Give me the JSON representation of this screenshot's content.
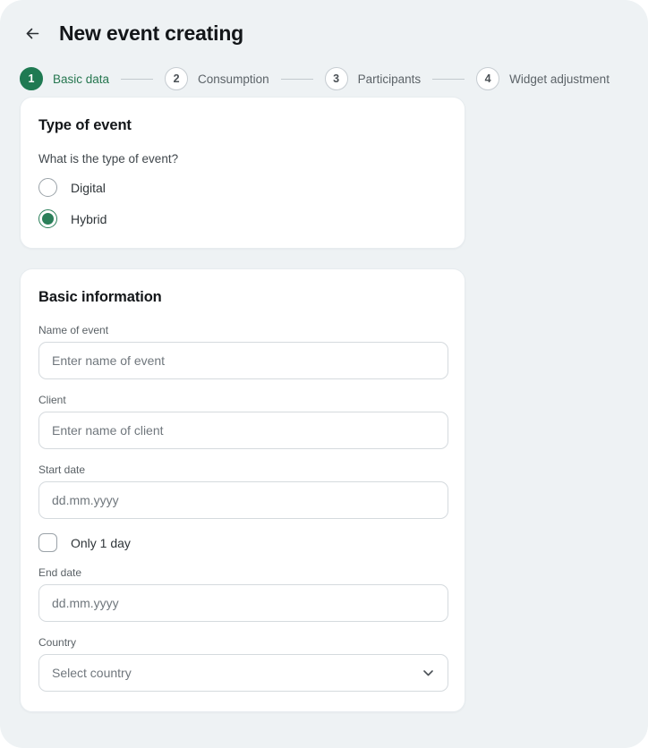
{
  "header": {
    "back_icon": "arrow-left-icon",
    "title": "New event creating"
  },
  "stepper": {
    "steps": [
      {
        "number": "1",
        "label": "Basic data",
        "state": "active"
      },
      {
        "number": "2",
        "label": "Consumption",
        "state": "inactive"
      },
      {
        "number": "3",
        "label": "Participants",
        "state": "inactive"
      },
      {
        "number": "4",
        "label": "Widget adjustment",
        "state": "inactive"
      }
    ],
    "active_color": "#1f7a52",
    "inactive_color": "#5c6368"
  },
  "type_of_event_card": {
    "title": "Type of event",
    "question": "What is the type of event?",
    "options": [
      {
        "label": "Digital",
        "selected": false
      },
      {
        "label": "Hybrid",
        "selected": true
      }
    ],
    "selected_color": "#2a7f59"
  },
  "basic_information_card": {
    "title": "Basic information",
    "fields": {
      "name_of_event": {
        "label": "Name of event",
        "placeholder": "Enter name of event",
        "value": ""
      },
      "client": {
        "label": "Client",
        "placeholder": "Enter name of client",
        "value": ""
      },
      "start_date": {
        "label": "Start date",
        "placeholder": "dd.mm.yyyy",
        "value": ""
      },
      "only_one_day": {
        "label": "Only 1 day",
        "checked": false
      },
      "end_date": {
        "label": "End date",
        "placeholder": "dd.mm.yyyy",
        "value": ""
      },
      "country": {
        "label": "Country",
        "placeholder": "Select country",
        "value": "",
        "chevron_icon": "chevron-down-icon"
      }
    }
  },
  "theme": {
    "page_background": "#eef2f4",
    "card_background": "#ffffff",
    "border_color": "#d5dade",
    "text_primary": "#131619",
    "text_secondary": "#5a6166"
  }
}
